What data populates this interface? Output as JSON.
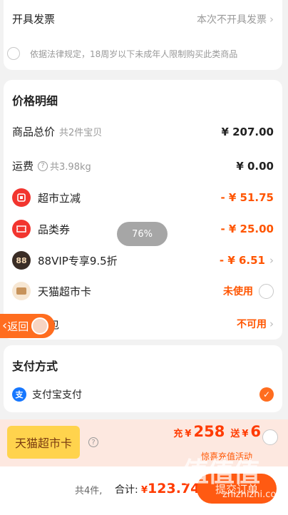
{
  "invoice": {
    "label": "开具发票",
    "value": "本次不开具发票"
  },
  "law_notice": "依据法律规定，18周岁以下未成年人限制购买此类商品",
  "price_detail": {
    "title": "价格明细",
    "items": [
      {
        "label": "商品总价",
        "sub": "共2件宝贝",
        "amount": "¥ 207.00"
      },
      {
        "label": "运费",
        "sub": "共3.98kg",
        "amount": "¥ 0.00"
      },
      {
        "label": "超市立减",
        "amount": "- ¥ 51.75"
      },
      {
        "label": "品类券",
        "amount": "- ¥ 25.00"
      },
      {
        "label": "88VIP专享9.5折",
        "amount": "- ¥ 6.51",
        "icon_text": "88"
      },
      {
        "label": "天猫超市卡",
        "status": "未使用"
      },
      {
        "label": "红包",
        "status": "不可用"
      }
    ]
  },
  "zoom": "76%",
  "back_button": "返回",
  "payment": {
    "title": "支付方式",
    "method": "支付宝支付",
    "icon_text": "支"
  },
  "promo": {
    "label": "天猫超市卡",
    "charge_prefix": "充",
    "charge_amount": "258",
    "gift_prefix": "送",
    "gift_amount": "6",
    "currency": "¥",
    "sub": "惊喜充值活动"
  },
  "bottom": {
    "count": "共4件,",
    "total_label": "合计:",
    "currency": "¥",
    "total": "123.74",
    "submit": "提交订单"
  },
  "watermark": {
    "logo": "值值值",
    "url": "zhizhizhi.com"
  },
  "colors": {
    "accent": "#ff5500",
    "brand_orange": "#ff6d1f",
    "discount_icon_red": "#f2352f",
    "alipay_blue": "#1677ff",
    "promo_yellow": "#ffd34d"
  }
}
